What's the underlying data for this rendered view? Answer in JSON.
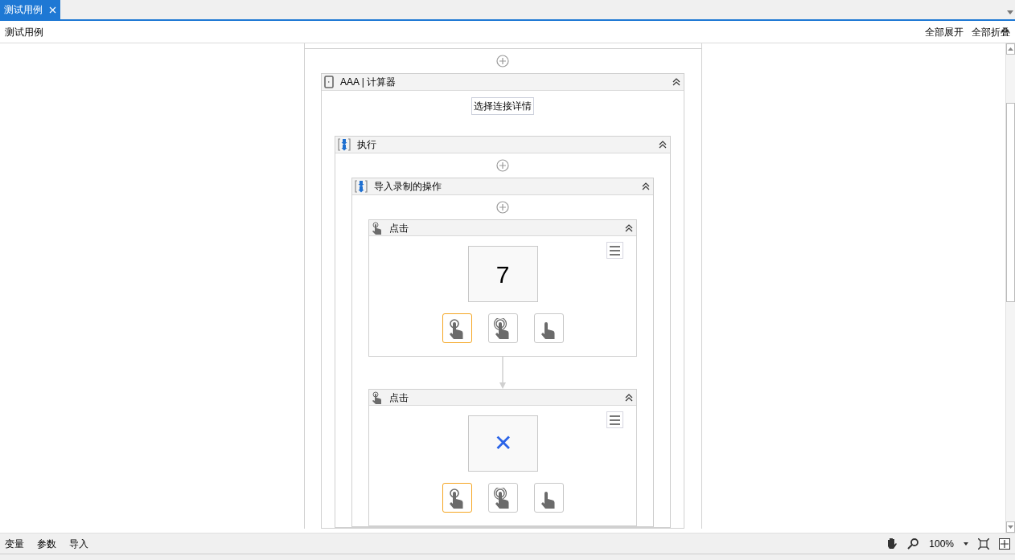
{
  "tabs": [
    {
      "label": "测试用例",
      "selected": true
    }
  ],
  "breadcrumb": "测试用例",
  "header_actions": [
    "全部展开",
    "全部折叠"
  ],
  "designer": {
    "activity": {
      "title": "AAA | 计算器",
      "button": "选择连接详情",
      "expanded": true
    },
    "execute": {
      "title": "执行",
      "expanded": true
    },
    "recorded": {
      "title": "导入录制的操作",
      "expanded": true
    },
    "steps": [
      {
        "title": "点击",
        "target": "7",
        "kind": "digit",
        "click_modes": [
          {
            "kind": "single",
            "selected": true
          },
          {
            "kind": "double",
            "selected": false
          },
          {
            "kind": "press",
            "selected": false
          }
        ]
      },
      {
        "title": "点击",
        "target": "✕",
        "kind": "symbol",
        "click_modes": [
          {
            "kind": "single",
            "selected": true
          },
          {
            "kind": "double",
            "selected": false
          },
          {
            "kind": "press",
            "selected": false
          }
        ]
      }
    ]
  },
  "bottom_tabs": [
    "变量",
    "参数",
    "导入"
  ],
  "zoom": "100%"
}
